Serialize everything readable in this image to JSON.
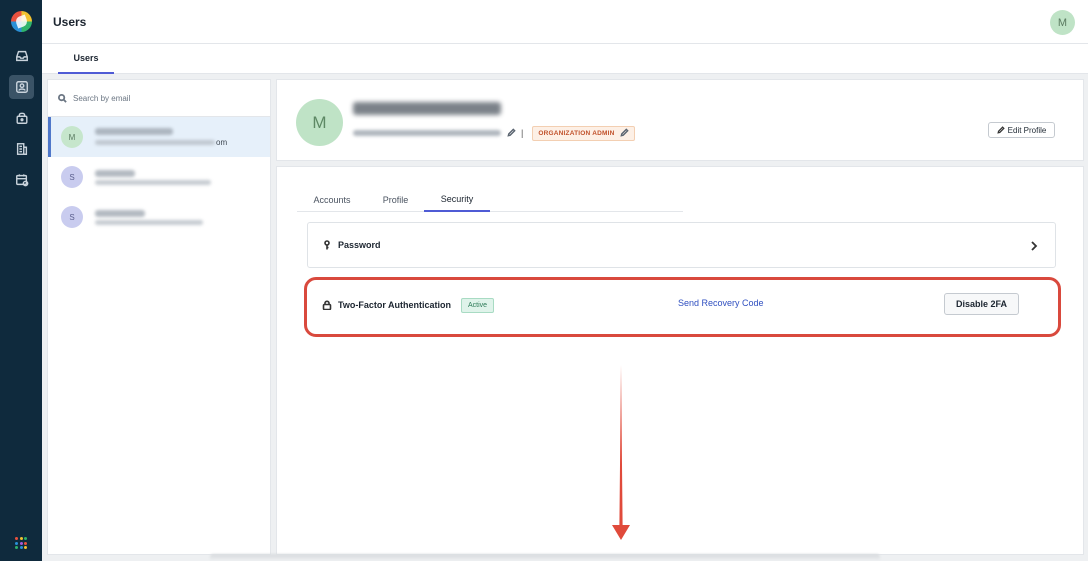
{
  "app": {
    "title": "Users",
    "user_initial": "M",
    "subnav_tab": "Users"
  },
  "rail": {
    "icons": [
      "app-logo",
      "inbox-icon",
      "user-card-icon",
      "lock-bag-icon",
      "building-icon",
      "calendar-icon",
      "apps-grid-icon"
    ],
    "active": "user-card-icon",
    "apps_dot_colors": [
      "#e9513e",
      "#f2c230",
      "#2fb36b",
      "#2a8fd6",
      "#a45ad9",
      "#e9513e",
      "#2fb36b",
      "#2a8fd6",
      "#f2c230"
    ]
  },
  "search": {
    "placeholder": "Search by email"
  },
  "users": [
    {
      "initial": "M",
      "email_tail": "om",
      "selected": true
    },
    {
      "initial": "S",
      "selected": false
    },
    {
      "initial": "S",
      "selected": false
    }
  ],
  "profile": {
    "initial": "M",
    "role": "ORGANIZATION ADMIN",
    "edit_label": "Edit Profile"
  },
  "tabs": [
    {
      "label": "Accounts",
      "active": false
    },
    {
      "label": "Profile",
      "active": false
    },
    {
      "label": "Security",
      "active": true
    }
  ],
  "security": {
    "password_label": "Password",
    "twofa_label": "Two-Factor Authentication",
    "twofa_status": "Active",
    "send_recovery": "Send Recovery Code",
    "disable_label": "Disable 2FA"
  },
  "annotation": {
    "highlight_color": "#d9493d",
    "arrow_color": "#e04a3b"
  }
}
